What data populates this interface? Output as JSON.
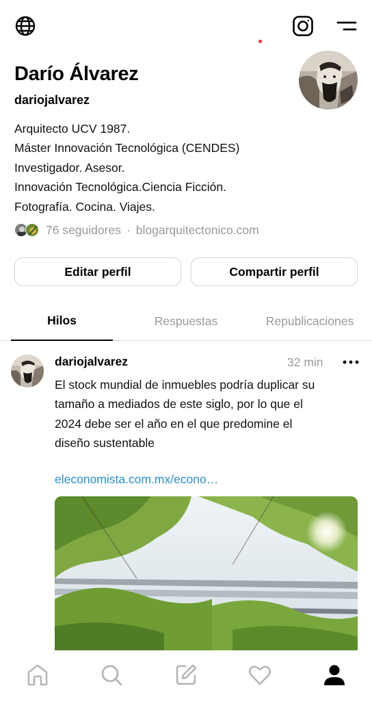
{
  "topbar": {
    "left_icon": "globe-icon",
    "right_icons": [
      "instagram-icon",
      "menu-icon"
    ]
  },
  "profile": {
    "name": "Darío Álvarez",
    "handle": "dariojalvarez",
    "bio": [
      "Arquitecto UCV 1987.",
      "Máster Innovación Tecnológica (CENDES)",
      "Investigador. Asesor.",
      "Innovación Tecnológica.Ciencia Ficción.",
      "Fotografía. Cocina. Viajes."
    ],
    "followers": "76 seguidores",
    "separator": "·",
    "link": "blogarquitectonico.com"
  },
  "actions": {
    "edit": "Editar perfil",
    "share": "Compartir perfil"
  },
  "tabs": [
    {
      "label": "Hilos",
      "active": true
    },
    {
      "label": "Respuestas",
      "active": false
    },
    {
      "label": "Republicaciones",
      "active": false
    }
  ],
  "post": {
    "user": "dariojalvarez",
    "time": "32 min",
    "text": [
      "El stock mundial de inmuebles podría duplicar su",
      "tamaño a mediados de este siglo, por lo que el",
      "2024 debe ser el año en el que predomine el",
      "diseño sustentable"
    ],
    "link": "eleconomista.com.mx/econo…"
  },
  "bottom_nav": {
    "items": [
      "home-icon",
      "search-icon",
      "compose-icon",
      "heart-icon",
      "profile-icon"
    ],
    "active": "profile-icon"
  },
  "colors": {
    "link": "#2a8fc4",
    "muted": "#999999",
    "notification": "#ff3040"
  }
}
